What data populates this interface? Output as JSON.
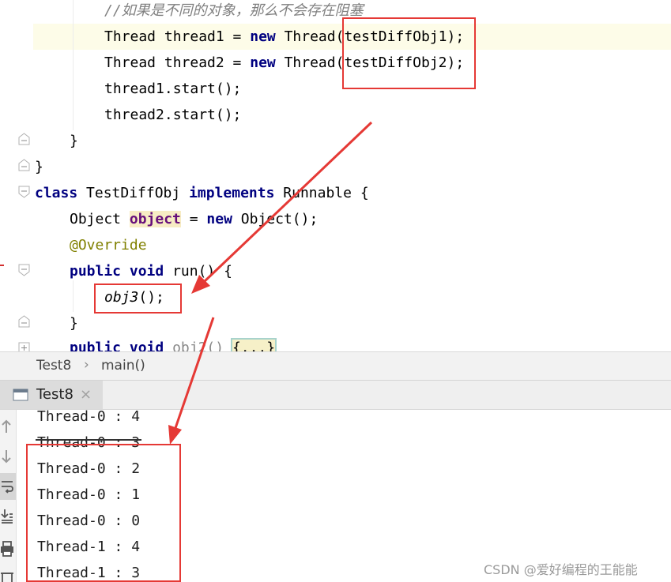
{
  "editor": {
    "lines": {
      "comment": "//如果是不同的对象，那么不会存在阻塞",
      "t1_a": "Thread thread1 = ",
      "t1_kw": "new",
      "t1_b": " Thread(testDiffObj1);",
      "t2_a": "Thread thread2 = ",
      "t2_kw": "new",
      "t2_b": " Thread(testDiffObj2);",
      "start1": "thread1.start();",
      "start2": "thread2.start();",
      "close_method": "}",
      "close_class": "}",
      "cls_kw": "class",
      "cls_name": " TestDiffObj ",
      "cls_impl": "implements",
      "cls_rest": " Runnable {",
      "obj_type": "Object ",
      "obj_field": "object",
      "obj_eq": " = ",
      "obj_new": "new",
      "obj_rest": " Object();",
      "annotation": "@Override",
      "run_pub": "public",
      "run_void": "void",
      "run_rest": " run() {",
      "call_fn": "obj3",
      "call_rest": "();",
      "close_run": "}",
      "next_pub": "public",
      "next_void": "void",
      "next_name": " obj2() ",
      "next_body": "{...}"
    }
  },
  "breadcrumb": {
    "class_name": "Test8",
    "separator": "›",
    "method": "main()"
  },
  "run_tab": {
    "label": "Test8",
    "close": "×"
  },
  "console": {
    "lines": [
      "Thread-0 : 4",
      "Thread-0 : 3",
      "Thread-0 : 2",
      "Thread-0 : 1",
      "Thread-0 : 0",
      "Thread-1 : 4",
      "Thread-1 : 3"
    ]
  },
  "watermark": "CSDN @爱好编程的王能能",
  "colors": {
    "highlight_red": "#e53935",
    "keyword": "#000080",
    "comment": "#808080",
    "annotation": "#808000"
  }
}
